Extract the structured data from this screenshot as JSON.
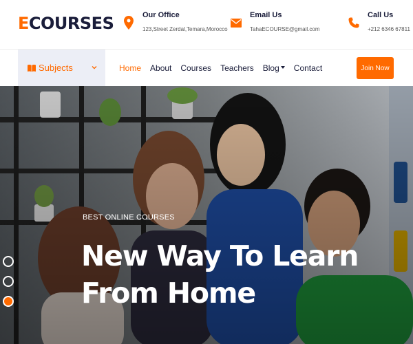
{
  "brand": {
    "logo_accent": "E",
    "logo_rest": "COURSES",
    "accent_color": "#ff6a00",
    "dark_color": "#1a1d3a"
  },
  "contacts": [
    {
      "title": "Our Office",
      "detail": "123,Street Zerdal,Temara,Morocco",
      "icon": "location-pin-icon"
    },
    {
      "title": "Email Us",
      "detail": "TahaECOURSE@gmail.com",
      "icon": "envelope-icon"
    },
    {
      "title": "Call Us",
      "detail": "+212 6346 67811",
      "icon": "phone-icon"
    }
  ],
  "nav": {
    "subjects_label": "Subjects",
    "items": [
      {
        "label": "Home",
        "active": true
      },
      {
        "label": "About",
        "active": false
      },
      {
        "label": "Courses",
        "active": false
      },
      {
        "label": "Teachers",
        "active": false
      },
      {
        "label": "Blog",
        "active": false,
        "dropdown": true
      },
      {
        "label": "Contact",
        "active": false
      }
    ],
    "join_label": "Join Now"
  },
  "hero": {
    "tagline": "BEST ONLINE COURSES",
    "title_line1": "New Way To Learn",
    "title_line2": "From Home",
    "slides_count": 3,
    "active_slide": 3
  }
}
